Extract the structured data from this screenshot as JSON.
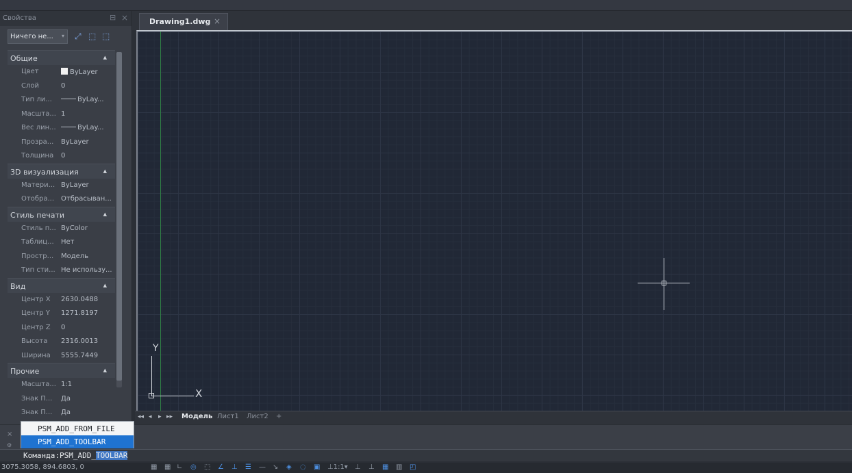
{
  "palette": {
    "title": "Свойства",
    "selection": "Ничего не...",
    "sections": [
      {
        "title": "Общие",
        "props": [
          {
            "label": "Цвет",
            "value": "ByLayer",
            "swatch": true
          },
          {
            "label": "Слой",
            "value": "0"
          },
          {
            "label": "Тип ли...",
            "value": "ByLay...",
            "line": true
          },
          {
            "label": "Масшта...",
            "value": "1"
          },
          {
            "label": "Вес лин...",
            "value": "ByLay...",
            "line": true
          },
          {
            "label": "Прозра...",
            "value": "ByLayer"
          },
          {
            "label": "Толщина",
            "value": "0"
          }
        ]
      },
      {
        "title": "3D визуализация",
        "props": [
          {
            "label": "Матери...",
            "value": "ByLayer"
          },
          {
            "label": "Отобра...",
            "value": "Отбрасыван..."
          }
        ]
      },
      {
        "title": "Стиль печати",
        "props": [
          {
            "label": "Стиль п...",
            "value": "ByColor"
          },
          {
            "label": "Таблиц...",
            "value": "Нет"
          },
          {
            "label": "Простр...",
            "value": "Модель"
          },
          {
            "label": "Тип сти...",
            "value": "Не использу..."
          }
        ]
      },
      {
        "title": "Вид",
        "props": [
          {
            "label": "Центр X",
            "value": "2630.0488"
          },
          {
            "label": "Центр Y",
            "value": "1271.8197"
          },
          {
            "label": "Центр Z",
            "value": "0"
          },
          {
            "label": "Высота",
            "value": "2316.0013"
          },
          {
            "label": "Ширина",
            "value": "5555.7449"
          }
        ]
      },
      {
        "title": "Прочие",
        "props": [
          {
            "label": "Масшта...",
            "value": "1:1"
          },
          {
            "label": "Знак П...",
            "value": "Да"
          },
          {
            "label": "Знак П...",
            "value": "Да"
          }
        ]
      }
    ]
  },
  "document": {
    "tab_name": "Drawing1.dwg",
    "close_glyph": "×"
  },
  "canvas": {
    "ucs_x_label": "X",
    "ucs_y_label": "Y"
  },
  "layout_tabs": {
    "nav": [
      "◂◂",
      "◂",
      "▸",
      "▸▸"
    ],
    "tabs": [
      "Модель",
      "Лист1",
      "Лист2",
      "+"
    ],
    "active": "Модель"
  },
  "autocomplete": {
    "items": [
      "PSM_ADD_FROM_FILE",
      "PSM_ADD_TOOLBAR"
    ],
    "selected": "PSM_ADD_TOOLBAR"
  },
  "command": {
    "prefix": "Команда:",
    "typed": "PSM_ADD_",
    "completion": "TOOLBAR"
  },
  "statusbar": {
    "coords": "3075.3058, 894.6803, 0"
  },
  "colors": {
    "canvas_bg": "#212836",
    "selection_blue": "#1f73d1",
    "panel_bg": "#3a3e46"
  }
}
